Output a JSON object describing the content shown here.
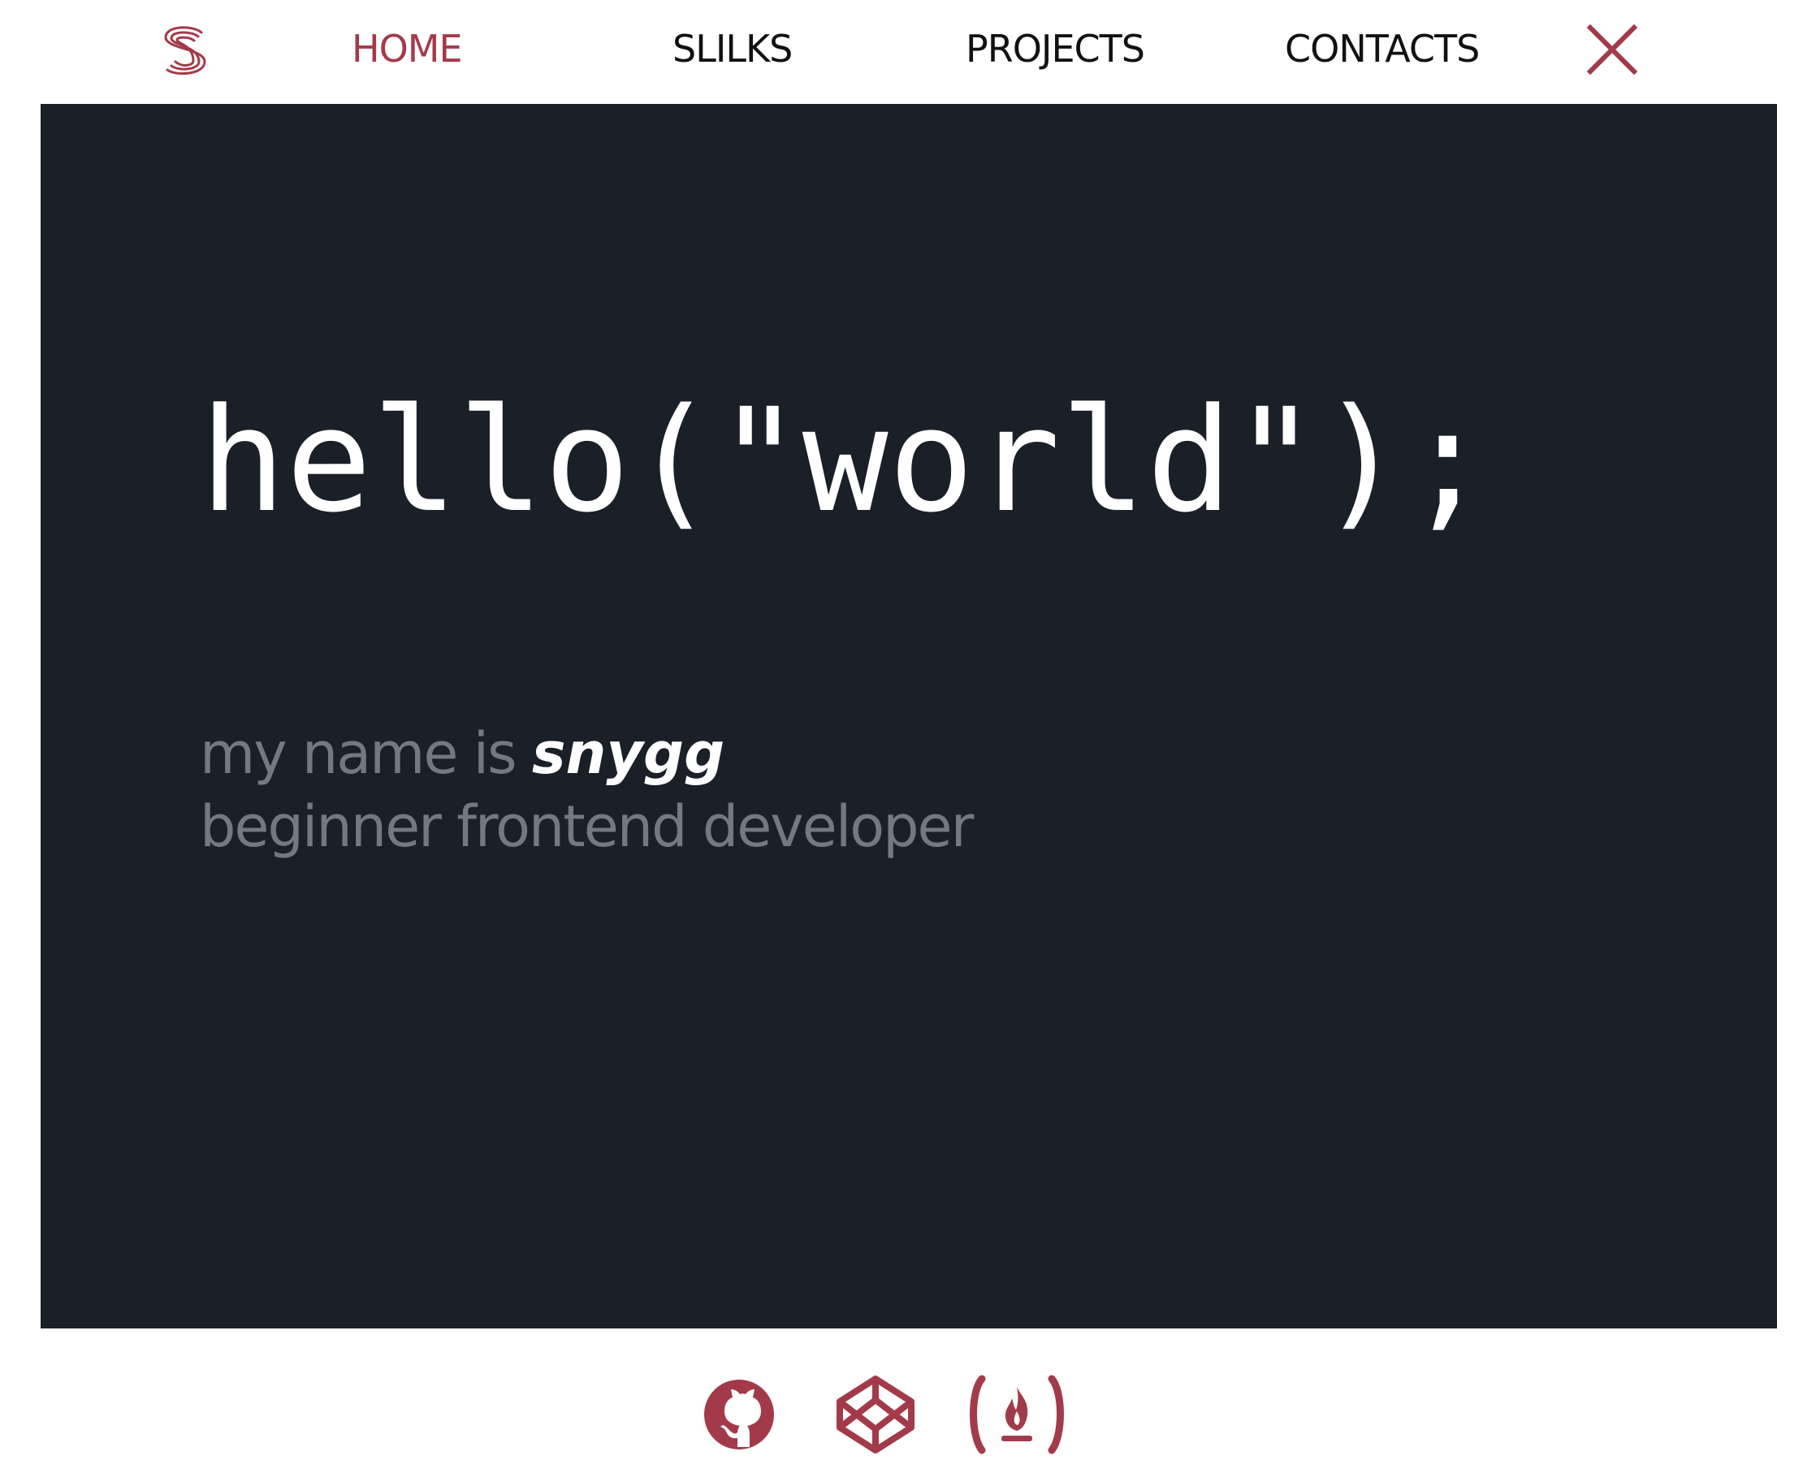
{
  "nav": {
    "logo_icon": "s-logo-icon",
    "items": [
      {
        "label": "HOME",
        "active": true
      },
      {
        "label": "SLILKS",
        "active": false
      },
      {
        "label": "PROJECTS",
        "active": false
      },
      {
        "label": "CONTACTS",
        "active": false
      }
    ],
    "close_icon": "close-icon"
  },
  "hero": {
    "headline": "hello(\"world\");",
    "intro_prefix": "my name is",
    "name": "snygg",
    "subtitle": "beginner frontend developer"
  },
  "social": [
    {
      "icon": "github-icon"
    },
    {
      "icon": "codepen-icon"
    },
    {
      "icon": "freecodecamp-icon"
    }
  ],
  "colors": {
    "accent": "#a33a4a",
    "hero_background": "#1a1f28",
    "hero_text": "#ffffff",
    "muted_text": "#747883",
    "nav_text": "#111111"
  }
}
